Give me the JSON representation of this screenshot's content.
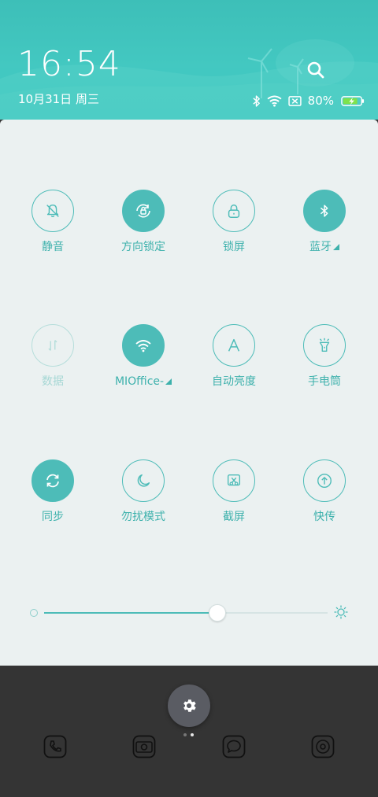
{
  "header": {
    "time": "16:54",
    "date": "10月31日 周三",
    "battery_percent": "80%",
    "icons": [
      "search-icon",
      "bluetooth-icon",
      "wifi-icon",
      "no-sim-icon",
      "battery-charging-icon"
    ]
  },
  "toggles": [
    {
      "label": "静音",
      "icon": "bell-off-icon",
      "state": "off"
    },
    {
      "label": "方向锁定",
      "icon": "rotation-lock-icon",
      "state": "on"
    },
    {
      "label": "锁屏",
      "icon": "lock-icon",
      "state": "off"
    },
    {
      "label": "蓝牙",
      "icon": "bluetooth-icon",
      "state": "on",
      "expandable": true
    },
    {
      "label": "数据",
      "icon": "mobile-data-icon",
      "state": "disabled"
    },
    {
      "label": "MIOffice-",
      "icon": "wifi-icon",
      "state": "on",
      "expandable": true
    },
    {
      "label": "自动亮度",
      "icon": "auto-brightness-icon",
      "state": "off"
    },
    {
      "label": "手电筒",
      "icon": "flashlight-icon",
      "state": "off"
    },
    {
      "label": "同步",
      "icon": "sync-icon",
      "state": "on"
    },
    {
      "label": "勿扰模式",
      "icon": "moon-icon",
      "state": "off"
    },
    {
      "label": "截屏",
      "icon": "screenshot-icon",
      "state": "off"
    },
    {
      "label": "快传",
      "icon": "quick-share-icon",
      "state": "off"
    }
  ],
  "brightness": {
    "level": 0.61
  },
  "dock": {
    "pager": {
      "pages": 2,
      "active": 2
    },
    "apps": [
      "phone-icon",
      "camera-icon",
      "messages-icon",
      "browser-icon"
    ],
    "settings_icon": "gear-icon"
  },
  "colors": {
    "accent": "#4dbcb8",
    "header": "#43c8c1",
    "panel": "#ebf1f1",
    "dock": "#343434"
  }
}
